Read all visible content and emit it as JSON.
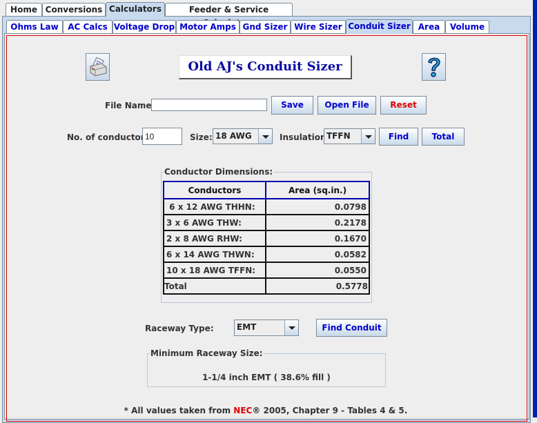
{
  "top_tabs": [
    {
      "label": "Home",
      "selected": false
    },
    {
      "label": "Conversions",
      "selected": false
    },
    {
      "label": "Calculators",
      "selected": true
    },
    {
      "label": "Feeder & Service Calculators",
      "selected": false
    }
  ],
  "sub_tabs": [
    {
      "label": "Ohms Law",
      "selected": false
    },
    {
      "label": "AC Calcs",
      "selected": false
    },
    {
      "label": "Voltage Drop",
      "selected": false
    },
    {
      "label": "Motor Amps",
      "selected": false
    },
    {
      "label": "Gnd Sizer",
      "selected": false
    },
    {
      "label": "Wire Sizer",
      "selected": false
    },
    {
      "label": "Conduit Sizer",
      "selected": true
    },
    {
      "label": "Area",
      "selected": false
    },
    {
      "label": "Volume",
      "selected": false
    }
  ],
  "header": {
    "title": "Old AJ's Conduit Sizer",
    "print_icon": "printer-icon",
    "help_icon": "question-mark-icon"
  },
  "file_row": {
    "label": "File Name:",
    "value": "",
    "placeholder": "",
    "save_label": "Save",
    "open_label": "Open File",
    "reset_label": "Reset"
  },
  "conductor_row": {
    "count_label": "No. of conductors:",
    "count_value": "10",
    "size_label": "Size:",
    "size_value": "18 AWG",
    "insulation_label": "Insulation:",
    "insulation_value": "TFFN",
    "find_label": "Find",
    "total_label": "Total"
  },
  "dimensions": {
    "group_title": "Conductor Dimensions:",
    "columns": [
      "Conductors",
      "Area (sq.in.)"
    ],
    "rows": [
      {
        "conductor": " 6 x 12 AWG THHN:",
        "area": "0.0798"
      },
      {
        "conductor": "3 x 6 AWG THW:",
        "area": "0.2178"
      },
      {
        "conductor": "2 x 8 AWG RHW:",
        "area": "0.1670"
      },
      {
        "conductor": "6 x 14 AWG THWN:",
        "area": "0.0582"
      },
      {
        "conductor": "10 x 18 AWG TFFN:",
        "area": "0.0550"
      }
    ],
    "total_label": "Total",
    "total_value": "0.5778"
  },
  "raceway": {
    "label": "Raceway Type:",
    "value": "EMT",
    "find_label": "Find Conduit"
  },
  "result": {
    "group_title": "Minimum Raceway Size:",
    "text": "1-1/4 inch EMT ( 38.6% fill )"
  },
  "footnote": {
    "prefix": "* All values taken from ",
    "nec": "NEC",
    "suffix": "® 2005, Chapter 9 - Tables 4 & 5."
  },
  "colors": {
    "accent_blue": "#0000cc",
    "reset_red": "#e00000",
    "tab_selected": "#c8daee"
  }
}
